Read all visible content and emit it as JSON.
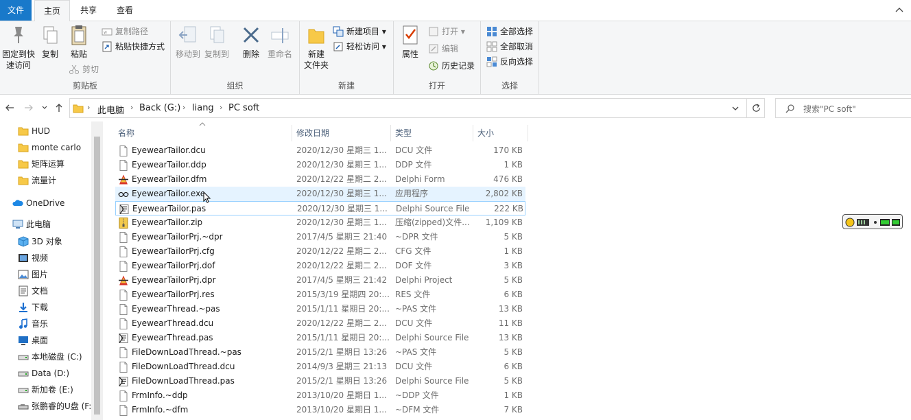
{
  "tabs": {
    "file": "文件",
    "home": "主页",
    "share": "共享",
    "view": "查看"
  },
  "ribbon": {
    "clipboard": {
      "label": "剪贴板",
      "pin_l1": "固定到快",
      "pin_l2": "速访问",
      "copy": "复制",
      "paste": "粘贴",
      "copy_path": "复制路径",
      "paste_shortcut": "粘贴快捷方式",
      "cut": "剪切"
    },
    "organize": {
      "label": "组织",
      "move_to": "移动到",
      "copy_to": "复制到",
      "delete": "删除",
      "rename": "重命名"
    },
    "new": {
      "label": "新建",
      "new_folder_l1": "新建",
      "new_folder_l2": "文件夹",
      "new_item": "新建项目",
      "easy_access": "轻松访问"
    },
    "open": {
      "label": "打开",
      "properties": "属性",
      "open": "打开",
      "edit": "编辑",
      "history": "历史记录"
    },
    "select": {
      "label": "选择",
      "select_all": "全部选择",
      "select_none": "全部取消",
      "invert": "反向选择"
    }
  },
  "address": {
    "crumbs": [
      "此电脑",
      "Back (G:)",
      "liang",
      "PC soft"
    ]
  },
  "search": {
    "placeholder": "搜索\"PC soft\""
  },
  "sidebar": [
    {
      "label": "HUD",
      "icon": "folder-icon"
    },
    {
      "label": "monte carlo",
      "icon": "folder-icon"
    },
    {
      "label": "矩阵运算",
      "icon": "folder-icon"
    },
    {
      "label": "流量计",
      "icon": "folder-icon"
    },
    {
      "label": "OneDrive",
      "icon": "cloud-icon"
    },
    {
      "label": "此电脑",
      "icon": "computer-icon"
    },
    {
      "label": "3D 对象",
      "icon": "cube-icon"
    },
    {
      "label": "视频",
      "icon": "video-icon"
    },
    {
      "label": "图片",
      "icon": "picture-icon"
    },
    {
      "label": "文档",
      "icon": "document-icon"
    },
    {
      "label": "下载",
      "icon": "download-icon"
    },
    {
      "label": "音乐",
      "icon": "music-icon"
    },
    {
      "label": "桌面",
      "icon": "desktop-icon"
    },
    {
      "label": "本地磁盘 (C:)",
      "icon": "drive-icon"
    },
    {
      "label": "Data (D:)",
      "icon": "drive-icon"
    },
    {
      "label": "新加卷 (E:)",
      "icon": "drive-icon"
    },
    {
      "label": "张鹏睿的U盘 (F:",
      "icon": "usb-drive-icon"
    }
  ],
  "columns": {
    "name": "名称",
    "date": "修改日期",
    "type": "类型",
    "size": "大小"
  },
  "files": [
    {
      "name": "EyewearTailor.dcu",
      "date": "2020/12/30 星期三 1...",
      "type": "DCU 文件",
      "size": "170 KB",
      "icon": "file-icon"
    },
    {
      "name": "EyewearTailor.ddp",
      "date": "2020/12/30 星期三 1...",
      "type": "DDP 文件",
      "size": "1 KB",
      "icon": "file-icon"
    },
    {
      "name": "EyewearTailor.dfm",
      "date": "2020/12/22 星期二 2...",
      "type": "Delphi Form",
      "size": "476 KB",
      "icon": "delphi-icon"
    },
    {
      "name": "EyewearTailor.exe",
      "date": "2020/12/30 星期三 1...",
      "type": "应用程序",
      "size": "2,802 KB",
      "icon": "glasses-icon"
    },
    {
      "name": "EyewearTailor.pas",
      "date": "2020/12/30 星期三 1...",
      "type": "Delphi Source File",
      "size": "222 KB",
      "icon": "delphi-source-icon"
    },
    {
      "name": "EyewearTailor.zip",
      "date": "2020/12/30 星期三 1...",
      "type": "压缩(zipped)文件...",
      "size": "1,109 KB",
      "icon": "zip-icon"
    },
    {
      "name": "EyewearTailorPrj.~dpr",
      "date": "2017/4/5 星期三 21:40",
      "type": "~DPR 文件",
      "size": "5 KB",
      "icon": "file-icon"
    },
    {
      "name": "EyewearTailorPrj.cfg",
      "date": "2020/12/22 星期二 2...",
      "type": "CFG 文件",
      "size": "1 KB",
      "icon": "file-icon"
    },
    {
      "name": "EyewearTailorPrj.dof",
      "date": "2020/12/22 星期二 2...",
      "type": "DOF 文件",
      "size": "3 KB",
      "icon": "file-icon"
    },
    {
      "name": "EyewearTailorPrj.dpr",
      "date": "2017/4/5 星期三 21:42",
      "type": "Delphi Project",
      "size": "5 KB",
      "icon": "delphi-icon"
    },
    {
      "name": "EyewearTailorPrj.res",
      "date": "2015/3/19 星期四 20:...",
      "type": "RES 文件",
      "size": "6 KB",
      "icon": "file-icon"
    },
    {
      "name": "EyewearThread.~pas",
      "date": "2015/1/11 星期日 20:...",
      "type": "~PAS 文件",
      "size": "13 KB",
      "icon": "file-icon"
    },
    {
      "name": "EyewearThread.dcu",
      "date": "2020/12/22 星期二 2...",
      "type": "DCU 文件",
      "size": "11 KB",
      "icon": "file-icon"
    },
    {
      "name": "EyewearThread.pas",
      "date": "2015/1/11 星期日 20:...",
      "type": "Delphi Source File",
      "size": "13 KB",
      "icon": "delphi-source-icon"
    },
    {
      "name": "FileDownLoadThread.~pas",
      "date": "2015/2/1 星期日 13:26",
      "type": "~PAS 文件",
      "size": "5 KB",
      "icon": "file-icon"
    },
    {
      "name": "FileDownLoadThread.dcu",
      "date": "2014/9/3 星期三 21:13",
      "type": "DCU 文件",
      "size": "6 KB",
      "icon": "file-icon"
    },
    {
      "name": "FileDownLoadThread.pas",
      "date": "2015/2/1 星期日 13:26",
      "type": "Delphi Source File",
      "size": "5 KB",
      "icon": "delphi-source-icon"
    },
    {
      "name": "FrmInfo.~ddp",
      "date": "2013/10/20 星期日 1...",
      "type": "~DDP 文件",
      "size": "1 KB",
      "icon": "file-icon"
    },
    {
      "name": "FrmInfo.~dfm",
      "date": "2013/10/20 星期日 1...",
      "type": "~DFM 文件",
      "size": "7 KB",
      "icon": "file-icon"
    }
  ]
}
